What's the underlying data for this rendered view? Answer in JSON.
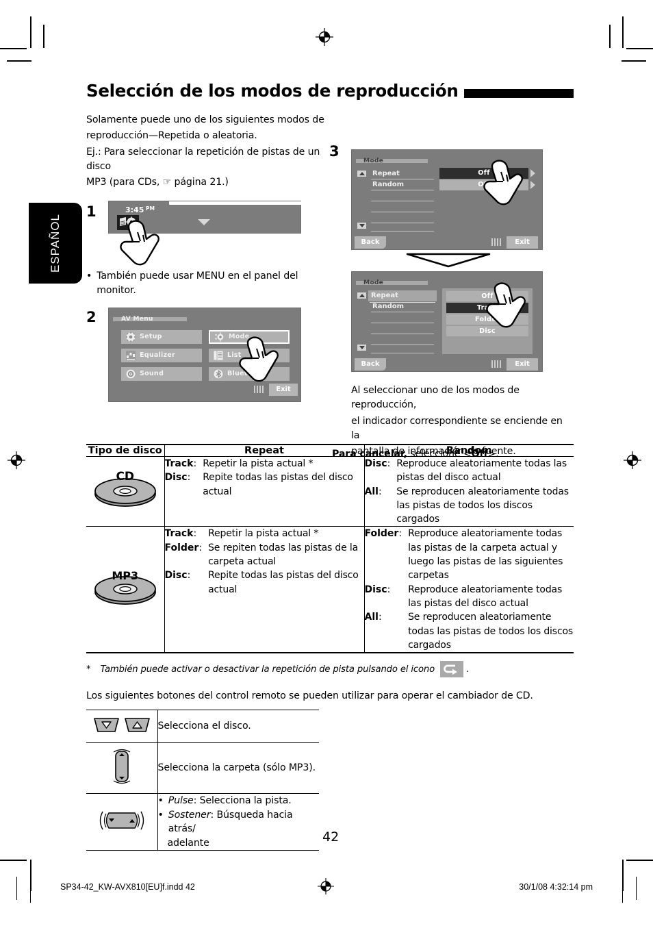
{
  "language_tab": "ESPAÑOL",
  "heading": "Selección de los modos de reproducción",
  "intro": {
    "line1": "Solamente puede uno de los siguientes modos de",
    "line2": "reproducción—Repetida o aleatoria.",
    "line3": "Ej.: Para seleccionar la repetición de pistas de un disco",
    "line4": "MP3 (para CDs, ☞ página 21.)"
  },
  "steps": {
    "one": "1",
    "two": "2",
    "three": "3"
  },
  "step1": {
    "clock_time": "3:45",
    "clock_meridiem": "PM",
    "source_icon": "source-mode-icon",
    "dropdown_icon": "chevron-down-icon",
    "note_bullet": "•",
    "note_line1": "También puede usar MENU en el panel del",
    "note_line2": "monitor."
  },
  "av_menu": {
    "title": "AV Menu",
    "items": [
      {
        "label": "Setup",
        "icon": "gear-icon",
        "selected": false
      },
      {
        "label": "Mode",
        "icon": "mode-icon",
        "selected": true
      },
      {
        "label": "Equalizer",
        "icon": "equalizer-icon",
        "selected": false
      },
      {
        "label": "List",
        "icon": "list-icon",
        "selected": false
      },
      {
        "label": "Sound",
        "icon": "sound-icon",
        "selected": false
      },
      {
        "label": "Bluetooth",
        "icon": "bluetooth-icon",
        "selected": false
      }
    ],
    "exit": "Exit"
  },
  "mode_screen_1": {
    "title": "Mode",
    "rows": [
      {
        "label": "Repeat",
        "value": "Off",
        "highlighted": true
      },
      {
        "label": "Random",
        "value": "Off",
        "highlighted": false
      }
    ],
    "back": "Back",
    "exit": "Exit",
    "scroll_up_icon": "scroll-up-icon",
    "scroll_down_icon": "scroll-down-icon"
  },
  "mode_screen_2": {
    "title": "Mode",
    "rows": [
      {
        "label": "Repeat",
        "selected": true
      },
      {
        "label": "Random",
        "selected": false
      }
    ],
    "options": [
      {
        "label": "Off",
        "selected": false
      },
      {
        "label": "Track",
        "selected": true
      },
      {
        "label": "Folder",
        "selected": false
      },
      {
        "label": "Disc",
        "selected": false
      }
    ],
    "back": "Back",
    "exit": "Exit",
    "scroll_up_icon": "scroll-up-icon",
    "scroll_down_icon": "scroll-down-icon"
  },
  "after_step3": {
    "line1": "Al seleccionar uno de los modos de reproducción,",
    "line2": "el indicador correspondiente se enciende en la",
    "line3": "pantalla de información de fuente."
  },
  "cancel_note": {
    "bold": "Para cancelar,",
    "rest": " seleccione <",
    "value": "Off",
    "tail": ">."
  },
  "table": {
    "headers": [
      "Tipo de disco",
      "Repeat",
      "Random"
    ],
    "rows": [
      {
        "disc_icon": "cd-disc-icon",
        "disc_label": "CD",
        "repeat": [
          {
            "term": "Track",
            "desc": "Repetir la pista actual *"
          },
          {
            "term": "Disc",
            "desc": "Repite todas las pistas del disco actual"
          }
        ],
        "random": [
          {
            "term": "Disc",
            "desc": "Reproduce aleatoriamente todas las pistas del disco actual"
          },
          {
            "term": "All",
            "desc": "Se reproducen aleatoriamente todas las pistas de todos los discos cargados"
          }
        ]
      },
      {
        "disc_icon": "mp3-disc-icon",
        "disc_label": "MP3",
        "repeat": [
          {
            "term": "Track",
            "desc": "Repetir la pista actual *"
          },
          {
            "term": "Folder",
            "desc": "Se repiten todas las pistas de la carpeta actual"
          },
          {
            "term": "Disc",
            "desc": "Repite todas las pistas del disco actual"
          }
        ],
        "random": [
          {
            "term": "Folder",
            "desc": "Reproduce aleatoriamente todas las pistas de la carpeta actual y luego las pistas de las siguientes carpetas"
          },
          {
            "term": "Disc",
            "desc": "Reproduce aleatoriamente todas las pistas del disco actual"
          },
          {
            "term": "All",
            "desc": "Se reproducen aleatoriamente todas las pistas de todos los discos cargados"
          }
        ]
      }
    ]
  },
  "footnote": {
    "marker": "*",
    "text_before": "También puede activar o desactivar la repetición de pista pulsando el icono",
    "icon": "repeat-track-icon",
    "text_after": "."
  },
  "remote_intro": "Los siguientes botones del control remoto se pueden utilizar para operar el cambiador de CD.",
  "remote_table": [
    {
      "icon": "disc-down-up-buttons-icon",
      "desc": "Selecciona el disco."
    },
    {
      "icon": "folder-rocker-button-icon",
      "desc": "Selecciona la carpeta (sólo MP3)."
    },
    {
      "icon": "track-seek-buttons-icon",
      "lines": [
        {
          "bullet": "•",
          "em": "Pulse",
          "rest": ": Selecciona la pista."
        },
        {
          "bullet": "•",
          "em": "Sostener",
          "rest": ": Búsqueda hacia atrás/"
        },
        {
          "bullet": "",
          "em": "",
          "rest": "adelante"
        }
      ]
    }
  ],
  "page_number": "42",
  "footer": {
    "left": "SP34-42_KW-AVX810[EU]f.indd   42",
    "center_icon": "registration-target-icon",
    "right": "30/1/08   4:32:14 pm"
  },
  "colors": {
    "screen_bg": "#7c7c7c",
    "button_gray": "#b0b0b0",
    "selected_dark": "#2e2e2e",
    "selected_white": "#ffffff",
    "accent_black": "#000000"
  }
}
